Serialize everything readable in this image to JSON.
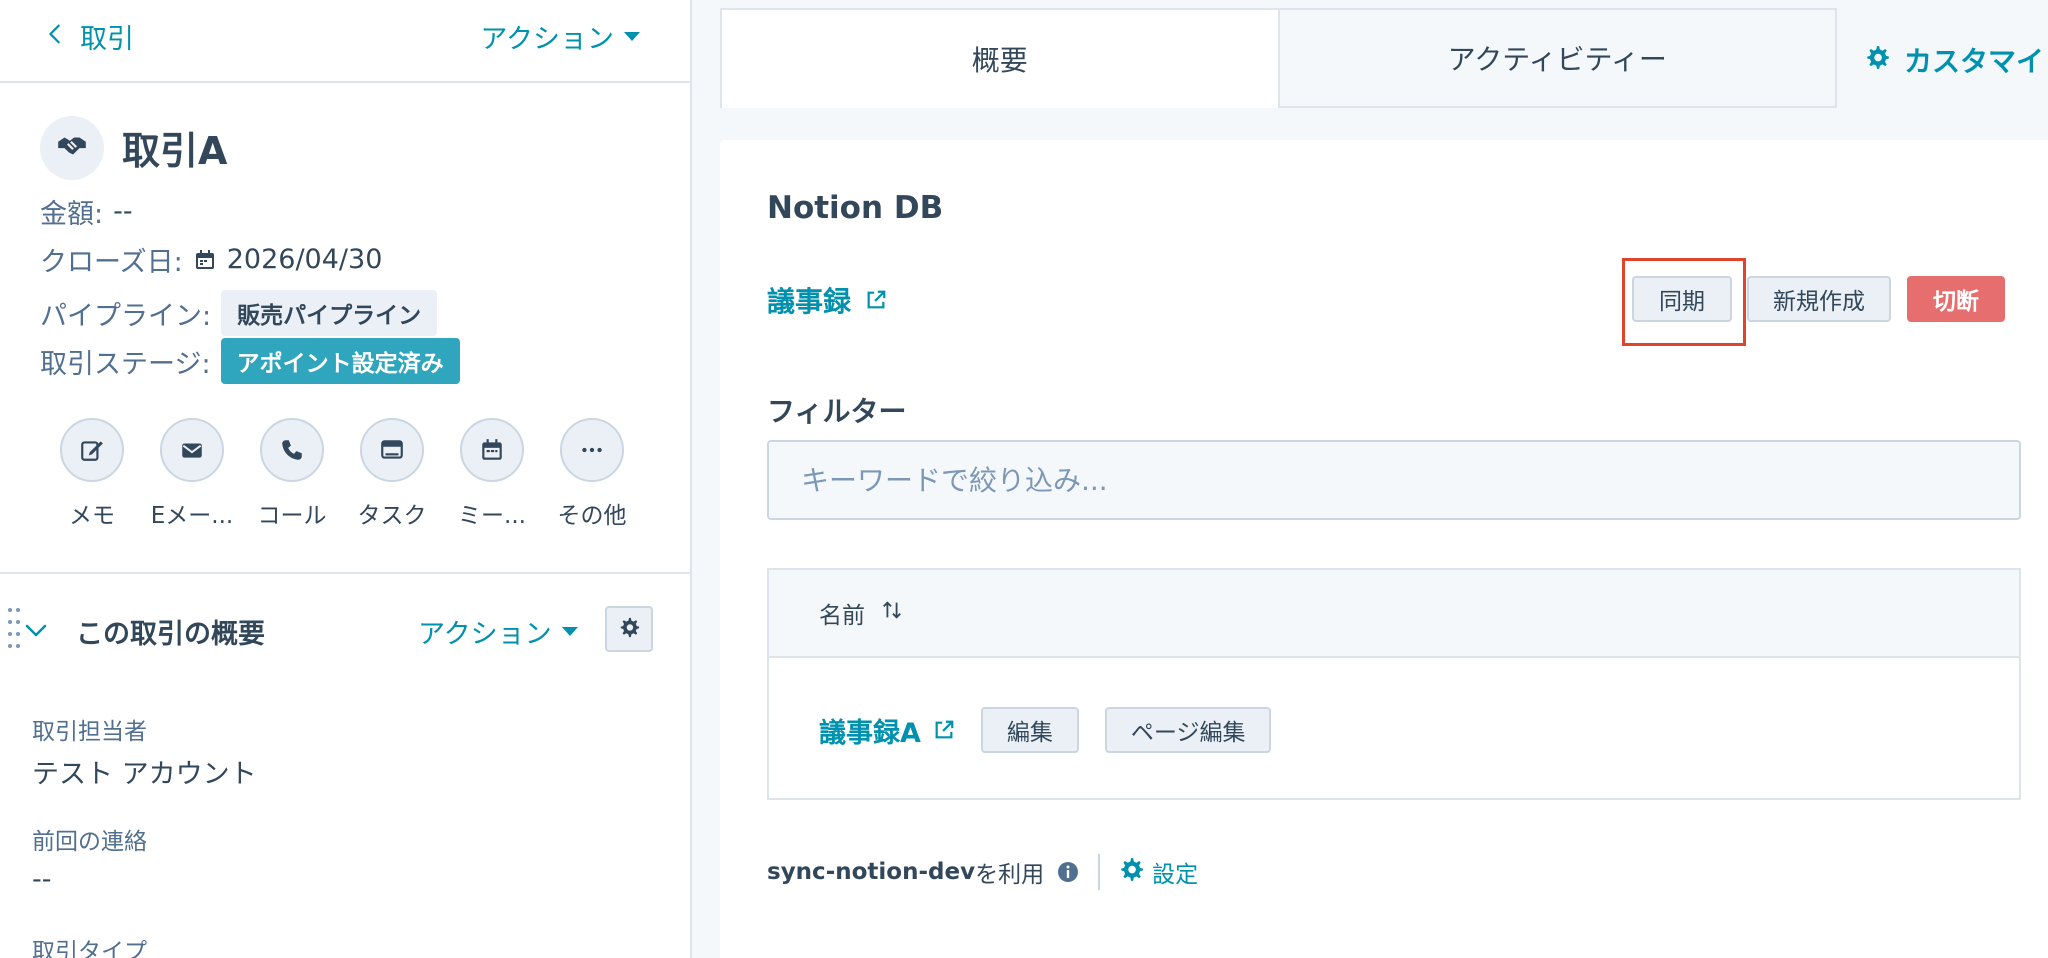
{
  "left": {
    "back_label": "取引",
    "actions_label": "アクション",
    "deal_name": "取引A",
    "amount_label": "金額:",
    "amount_value": "--",
    "close_date_label": "クローズ日:",
    "close_date_value": "2026/04/30",
    "pipeline_label": "パイプライン:",
    "pipeline_value": "販売パイプライン",
    "stage_label": "取引ステージ:",
    "stage_value": "アポイント設定済み",
    "stage_color": "#2fa6bd",
    "quick_actions": [
      {
        "label": "メモ",
        "icon": "note-edit-icon"
      },
      {
        "label": "Eメー...",
        "icon": "email-icon"
      },
      {
        "label": "コール",
        "icon": "phone-icon"
      },
      {
        "label": "タスク",
        "icon": "task-icon"
      },
      {
        "label": "ミー...",
        "icon": "calendar-icon"
      },
      {
        "label": "その他",
        "icon": "more-icon"
      }
    ],
    "section_title": "この取引の概要",
    "section_actions_label": "アクション",
    "fields": [
      {
        "label": "取引担当者",
        "value": "テスト アカウント"
      },
      {
        "label": "前回の連絡",
        "value": "--"
      },
      {
        "label": "取引タイプ",
        "value": ""
      }
    ]
  },
  "tabs": [
    {
      "label": "概要",
      "active": true
    },
    {
      "label": "アクティビティー",
      "active": false
    }
  ],
  "customize_label": "カスタマイ",
  "card": {
    "title": "Notion DB",
    "db_link": "議事録",
    "sync_label": "同期",
    "new_label": "新規作成",
    "disconnect_label": "切断",
    "disconnect_color": "#e66e6e",
    "highlight_color": "#e0442b",
    "filter_title": "フィルター",
    "search_placeholder": "キーワードで絞り込み...",
    "table": {
      "column_name": "名前",
      "rows": [
        {
          "name": "議事録A",
          "edit_label": "編集",
          "page_edit_label": "ページ編集"
        }
      ]
    },
    "footer_app": "sync-notion-dev",
    "footer_suffix": "を利用",
    "settings_label": "設定"
  },
  "accent_color": "#0091ae"
}
